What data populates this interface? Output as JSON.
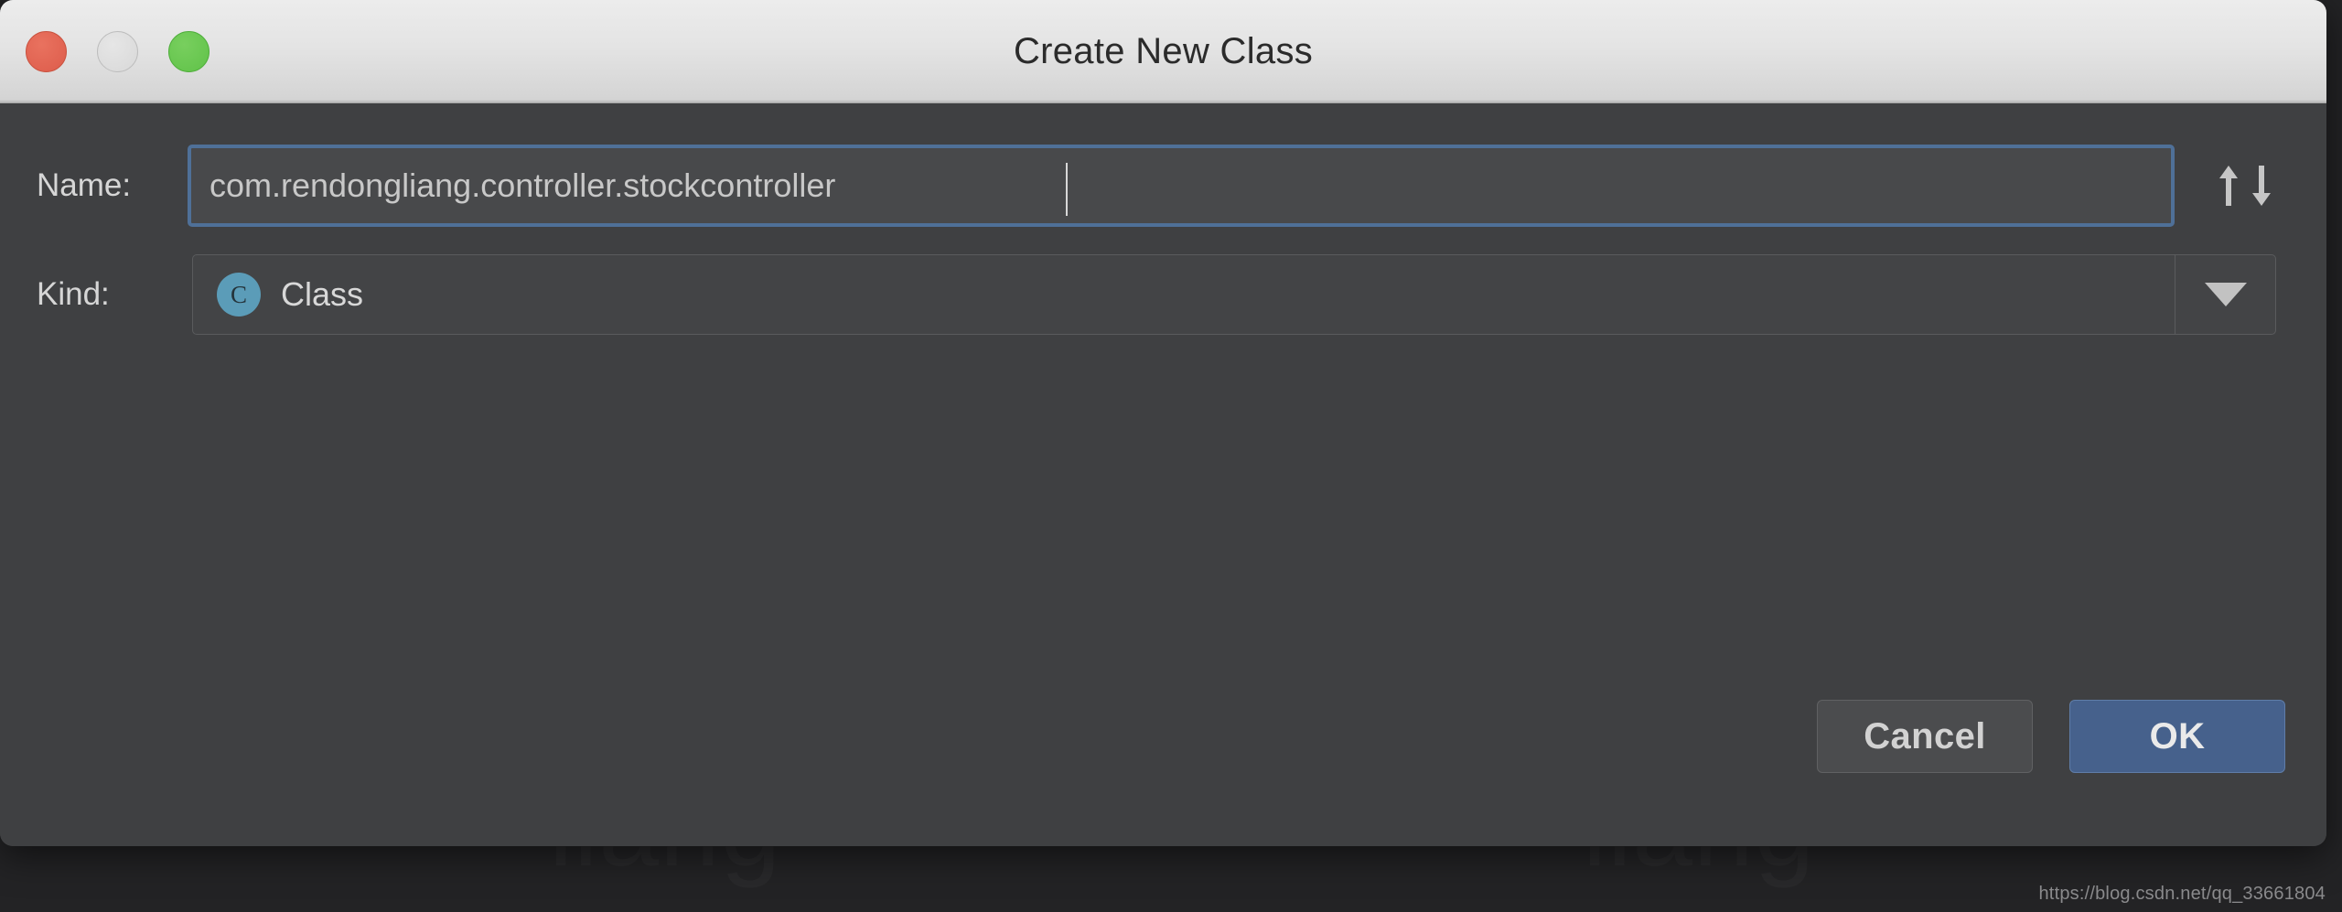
{
  "window": {
    "title": "Create New Class",
    "traffic_lights": [
      {
        "name": "close",
        "color": "#dd5c4b"
      },
      {
        "name": "minimize",
        "color": "#d8d8d8"
      },
      {
        "name": "maximize",
        "color": "#60c249"
      }
    ]
  },
  "form": {
    "name": {
      "label": "Name:",
      "value": "com.rendongliang.controller.stockcontroller",
      "placeholder": "",
      "focused": true,
      "focus_border_color": "#4f7098",
      "updown_icon": "up-down-arrows-icon"
    },
    "kind": {
      "label": "Kind:",
      "selected": "Class",
      "icon_letter": "C",
      "icon_color": "#5b9cb8",
      "dropdown_icon": "chevron-down-icon",
      "options": [
        "Class"
      ]
    }
  },
  "footer": {
    "cancel_label": "Cancel",
    "ok_label": "OK",
    "ok_accent_color": "#46618c"
  },
  "background": {
    "ghost_text_left": "liang",
    "ghost_text_right": "liang",
    "watermark": "https://blog.csdn.net/qq_33661804"
  }
}
